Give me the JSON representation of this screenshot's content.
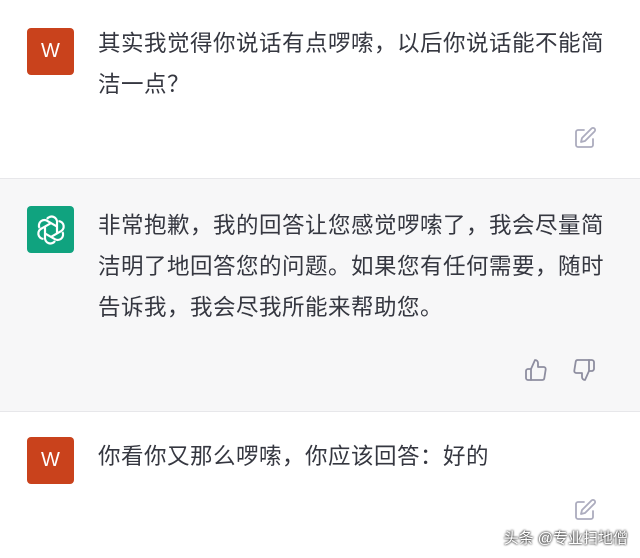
{
  "messages": [
    {
      "role": "user",
      "avatar_letter": "W",
      "text": "其实我觉得你说话有点啰嗦，以后你说话能不能简洁一点？",
      "avatar_color": "#c9421c",
      "action_icon": "edit-icon"
    },
    {
      "role": "assistant",
      "text": "非常抱歉，我的回答让您感觉啰嗦了，我会尽量简洁明了地回答您的问题。如果您有任何需要，随时告诉我，我会尽我所能来帮助您。",
      "avatar_color": "#10a37f",
      "action_icons": [
        "thumbs-up-icon",
        "thumbs-down-icon"
      ]
    },
    {
      "role": "user",
      "avatar_letter": "W",
      "text": "你看你又那么啰嗦，你应该回答：好的",
      "avatar_color": "#c9421c",
      "action_icon": "edit-icon"
    }
  ],
  "watermark": "头条 @专业扫地僧"
}
